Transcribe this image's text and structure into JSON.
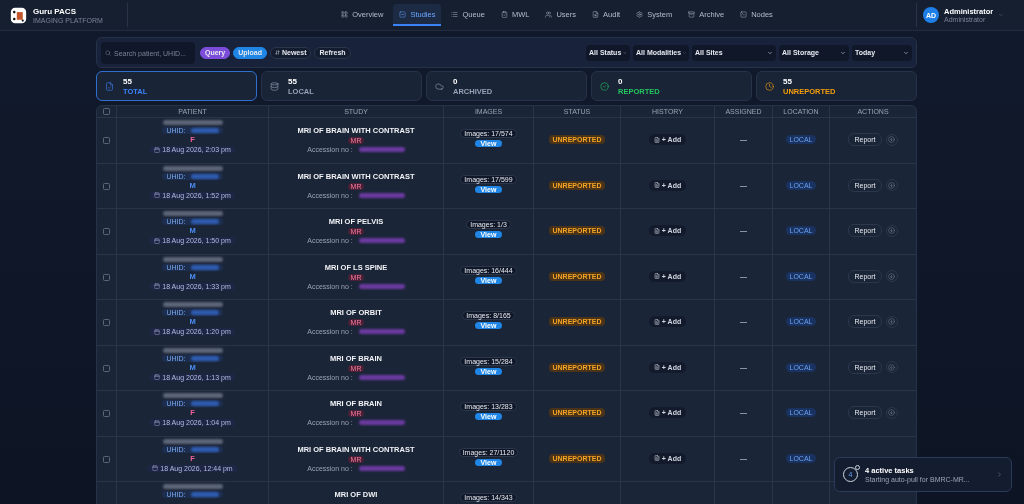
{
  "brand": {
    "name": "Guru PACS",
    "tagline": "IMAGING PLATFORM"
  },
  "nav": [
    {
      "label": "Overview",
      "selected": false
    },
    {
      "label": "Studies",
      "selected": true
    },
    {
      "label": "Queue",
      "selected": false
    },
    {
      "label": "MWL",
      "selected": false
    },
    {
      "label": "Users",
      "selected": false
    },
    {
      "label": "Audit",
      "selected": false
    },
    {
      "label": "System",
      "selected": false
    },
    {
      "label": "Archive",
      "selected": false
    },
    {
      "label": "Nodes",
      "selected": false
    }
  ],
  "user": {
    "initials": "AD",
    "name": "Administrator",
    "role": "Administrator"
  },
  "toolbar": {
    "search": {
      "placeholder": "Search patient, UHID..."
    },
    "buttons": [
      {
        "label": "Query",
        "kind": "filled",
        "color": "#7c4ddb"
      },
      {
        "label": "Upload",
        "kind": "filled",
        "color": "#1f86e6"
      },
      {
        "label": "Newest",
        "kind": "sort"
      },
      {
        "label": "Refresh",
        "kind": "plain"
      }
    ],
    "filters": [
      "All Status",
      "All Modalities",
      "All Sites",
      "All Storage",
      "Today"
    ]
  },
  "stats": [
    {
      "value": "55",
      "label": "TOTAL",
      "color": "#3b82f6",
      "selected": true
    },
    {
      "value": "55",
      "label": "LOCAL",
      "color": "#94a3b8",
      "selected": false
    },
    {
      "value": "0",
      "label": "ARCHIVED",
      "color": "#94a3b8",
      "selected": false
    },
    {
      "value": "0",
      "label": "REPORTED",
      "color": "#22c55e",
      "selected": false
    },
    {
      "value": "55",
      "label": "UNREPORTED",
      "color": "#f59e0b",
      "selected": false
    }
  ],
  "table": {
    "select_all": {
      "checked": false
    },
    "columns": [
      "PATIENT",
      "STUDY",
      "IMAGES",
      "STATUS",
      "HISTORY",
      "ASSIGNED",
      "LOCATION",
      "ACTIONS"
    ],
    "rows": [
      {
        "checked": false,
        "uhid_label": "UHID:",
        "gender": {
          "text": "F",
          "color": "#f0609a"
        },
        "date": "18 Aug 2026, 2:03 pm",
        "study": "MRI OF BRAIN WITH CONTRAST",
        "modality": "MR",
        "accession_label": "Accession no :",
        "images": "Images: 17/574",
        "view": "View",
        "status": "UNREPORTED",
        "history": "+ Add",
        "assigned": "—",
        "location": "LOCAL",
        "action": "Report"
      },
      {
        "checked": false,
        "uhid_label": "UHID:",
        "gender": {
          "text": "M",
          "color": "#4a8cf0"
        },
        "date": "18 Aug 2026, 1:52 pm",
        "study": "MRI OF BRAIN WITH CONTRAST",
        "modality": "MR",
        "accession_label": "Accession no :",
        "images": "Images: 17/599",
        "view": "View",
        "status": "UNREPORTED",
        "history": "+ Add",
        "assigned": "—",
        "location": "LOCAL",
        "action": "Report"
      },
      {
        "checked": false,
        "uhid_label": "UHID:",
        "gender": {
          "text": "M",
          "color": "#4a8cf0"
        },
        "date": "18 Aug 2026, 1:50 pm",
        "study": "MRI OF PELVIS",
        "modality": "MR",
        "accession_label": "Accession no :",
        "images": "Images: 1/3",
        "view": "View",
        "status": "UNREPORTED",
        "history": "+ Add",
        "assigned": "—",
        "location": "LOCAL",
        "action": "Report"
      },
      {
        "checked": false,
        "uhid_label": "UHID:",
        "gender": {
          "text": "M",
          "color": "#4a8cf0"
        },
        "date": "18 Aug 2026, 1:33 pm",
        "study": "MRI OF LS SPINE",
        "modality": "MR",
        "accession_label": "Accession no :",
        "images": "Images: 16/444",
        "view": "View",
        "status": "UNREPORTED",
        "history": "+ Add",
        "assigned": "—",
        "location": "LOCAL",
        "action": "Report"
      },
      {
        "checked": false,
        "uhid_label": "UHID:",
        "gender": {
          "text": "M",
          "color": "#4a8cf0"
        },
        "date": "18 Aug 2026, 1:20 pm",
        "study": "MRI OF ORBIT",
        "modality": "MR",
        "accession_label": "Accession no :",
        "images": "Images: 8/165",
        "view": "View",
        "status": "UNREPORTED",
        "history": "+ Add",
        "assigned": "—",
        "location": "LOCAL",
        "action": "Report"
      },
      {
        "checked": false,
        "uhid_label": "UHID:",
        "gender": {
          "text": "M",
          "color": "#4a8cf0"
        },
        "date": "18 Aug 2026, 1:13 pm",
        "study": "MRI OF BRAIN",
        "modality": "MR",
        "accession_label": "Accession no :",
        "images": "Images: 15/284",
        "view": "View",
        "status": "UNREPORTED",
        "history": "+ Add",
        "assigned": "—",
        "location": "LOCAL",
        "action": "Report"
      },
      {
        "checked": false,
        "uhid_label": "UHID:",
        "gender": {
          "text": "F",
          "color": "#f0609a"
        },
        "date": "18 Aug 2026, 1:04 pm",
        "study": "MRI OF BRAIN",
        "modality": "MR",
        "accession_label": "Accession no :",
        "images": "Images: 13/283",
        "view": "View",
        "status": "UNREPORTED",
        "history": "+ Add",
        "assigned": "—",
        "location": "LOCAL",
        "action": "Report"
      },
      {
        "checked": false,
        "uhid_label": "UHID:",
        "gender": {
          "text": "F",
          "color": "#f0609a"
        },
        "date": "18 Aug 2026, 12:44 pm",
        "study": "MRI OF BRAIN WITH CONTRAST",
        "modality": "MR",
        "accession_label": "Accession no :",
        "images": "Images: 27/1120",
        "view": "View",
        "status": "UNREPORTED",
        "history": "+ Add",
        "assigned": "—",
        "location": "LOCAL"
      },
      {
        "uhid_label": "UHID:",
        "study": "MRI OF DWI",
        "images": "Images: 14/343"
      }
    ]
  },
  "toast": {
    "count": "4",
    "title": "4 active tasks",
    "message": "Starting auto-pull for BMRC-MR..."
  }
}
